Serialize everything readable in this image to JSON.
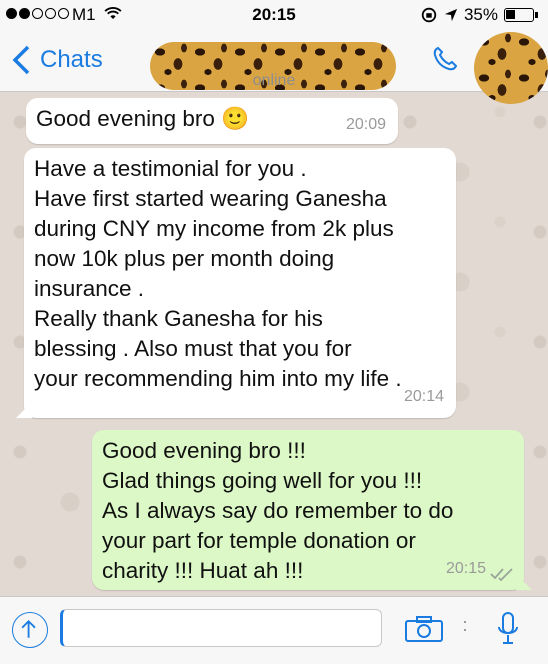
{
  "status_bar": {
    "carrier": "M1",
    "time": "20:15",
    "battery": "35%"
  },
  "nav": {
    "back_label": "Chats",
    "contact_status": "online"
  },
  "messages": [
    {
      "direction": "incoming",
      "text": "Good evening bro 🙂",
      "time": "20:09"
    },
    {
      "direction": "incoming",
      "text": "Have a testimonial for you .\nHave first started wearing Ganesha\nduring CNY my income from 2k plus\nnow 10k plus per month doing\ninsurance .\nReally thank Ganesha  for his\nblessing . Also must that you for\nyour recommending him into my life .",
      "time": "20:14"
    },
    {
      "direction": "outgoing",
      "text": "Good evening bro !!!\nGlad things going well for you !!!\nAs I always say do remember to do\nyour part for temple donation or\ncharity !!! Huat ah !!!",
      "time": "20:15",
      "read_receipt": "double-check"
    }
  ],
  "composer": {
    "input_value": ""
  },
  "colors": {
    "accent": "#1a7ce0",
    "outgoing_bubble": "#dcf8c6",
    "incoming_bubble": "#ffffff"
  }
}
